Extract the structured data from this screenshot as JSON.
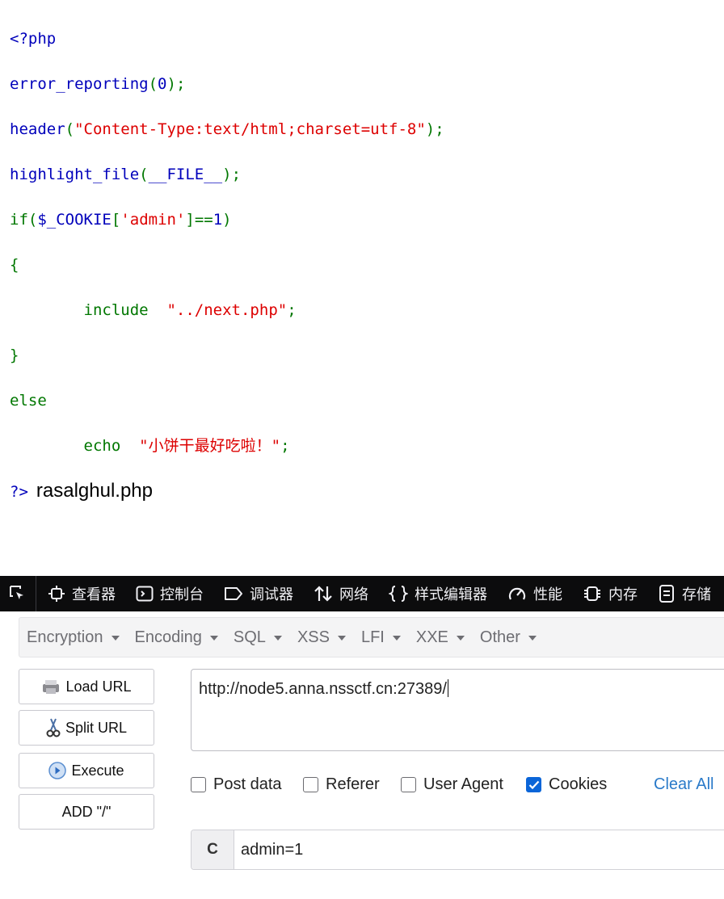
{
  "code": {
    "open_tag": "<?php",
    "line1": {
      "func": "error_reporting",
      "open": "(",
      "arg": "0",
      "close": ");"
    },
    "line2": {
      "func": "header",
      "open": "(",
      "arg": "\"Content-Type:text/html;charset=utf-8\"",
      "close": ");"
    },
    "line3": {
      "func": "highlight_file",
      "open": "(",
      "arg": "__FILE__",
      "close": ");"
    },
    "line4": {
      "kw": "if",
      "open": "(",
      "var": "$_COOKIE",
      "lb": "[",
      "key": "'admin'",
      "rb": "]==",
      "num": "1",
      "close": ")"
    },
    "brace_open": "{",
    "include_kw": "include",
    "include_arg": "\"../next.php\"",
    "include_end": ";",
    "brace_close": "}",
    "else_kw": "else",
    "echo_kw": "echo",
    "echo_arg": "\"小饼干最好吃啦！\"",
    "echo_end": ";",
    "close_tag": "?>",
    "after_file": "rasalghul.php"
  },
  "devtools": {
    "tabs": [
      {
        "label": "查看器",
        "icon": "inspector-icon"
      },
      {
        "label": "控制台",
        "icon": "console-icon"
      },
      {
        "label": "调试器",
        "icon": "debugger-icon"
      },
      {
        "label": "网络",
        "icon": "network-icon"
      },
      {
        "label": "样式编辑器",
        "icon": "style-editor-icon"
      },
      {
        "label": "性能",
        "icon": "performance-icon"
      },
      {
        "label": "内存",
        "icon": "memory-icon"
      },
      {
        "label": "存储",
        "icon": "storage-icon"
      }
    ]
  },
  "hackbar": {
    "menu": [
      "Encryption",
      "Encoding",
      "SQL",
      "XSS",
      "LFI",
      "XXE",
      "Other"
    ],
    "buttons": {
      "load": "Load URL",
      "split": "Split URL",
      "execute": "Execute",
      "add": "ADD \"/\""
    },
    "url": "http://node5.anna.nssctf.cn:27389/",
    "options": {
      "post": {
        "label": "Post data",
        "checked": false
      },
      "referer": {
        "label": "Referer",
        "checked": false
      },
      "user_agent": {
        "label": "User Agent",
        "checked": false
      },
      "cookies": {
        "label": "Cookies",
        "checked": true
      }
    },
    "clear_all": "Clear All",
    "cookie_label": "C",
    "cookie_value": "admin=1"
  }
}
